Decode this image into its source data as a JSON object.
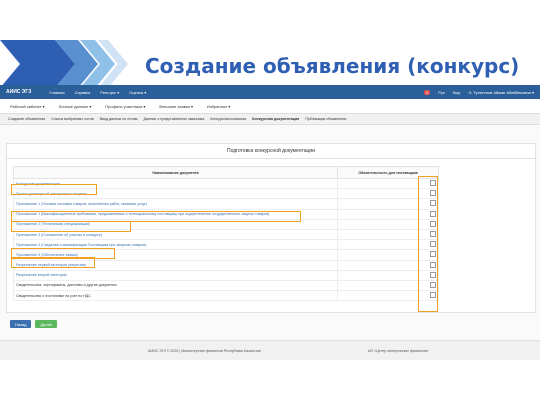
{
  "slide": {
    "title": "Создание объявления (конкурс)",
    "colors": {
      "title": "#2e5fb3",
      "logo_dark": "#2e5fb3",
      "logo_light": "#8fc0e8",
      "highlight": "#f0a020"
    }
  },
  "app": {
    "brand": "АИИС ЭГЗ",
    "nav": [
      "Главная",
      "Справка",
      "Реестры ▾",
      "Оценка ▾"
    ],
    "notif_count": "2",
    "lang": [
      "Рус",
      "Кыр"
    ],
    "user": "Э. Тулегенов Айжан Абайбековна ▾"
  },
  "subnav": [
    "Рабочий кабинет ▾",
    "Личные данные ▾",
    "Профиль участника ▾",
    "Внешние заявки ▾",
    "Избранное ▾"
  ],
  "tabs": [
    {
      "label": "Создание объявления",
      "active": false
    },
    {
      "label": "Список выбранных лотов",
      "active": false
    },
    {
      "label": "Ввод данных по лотам",
      "active": false
    },
    {
      "label": "Данные о представителях заказчика",
      "active": false
    },
    {
      "label": "Конкурсная комиссия",
      "active": false
    },
    {
      "label": "Конкурсная документация",
      "active": true
    },
    {
      "label": "Публикация объявления",
      "active": false
    }
  ],
  "panel": {
    "title": "Подготовка конкурсной документации",
    "columns": [
      "Наименование документа",
      "Обязательность для поставщика"
    ],
    "rows": [
      {
        "name": "Конкурсная документация",
        "link": true
      },
      {
        "name": "Проект договора об электронных закупках",
        "link": true
      },
      {
        "name": "Приложение 1 (Условия поставки товаров, выполнения работ, оказания услуг)",
        "link": true
      },
      {
        "name": "Приложение 1 (Квалификационные требования, предъявляемые к потенциальному поставщику при осуществлении государственных закупок товаров)",
        "link": true
      },
      {
        "name": "Приложение 2 (Техническая спецификация)",
        "link": true
      },
      {
        "name": "Приложение 3 (Соглашение об участии в конкурсе)",
        "link": true
      },
      {
        "name": "Приложение 4 (Сведения о квалификации Поставщика при закупках товаров)",
        "link": true
      },
      {
        "name": "Приложение 5 (Обеспечение заявки)",
        "link": true
      },
      {
        "name": "Разрешение первой категории (лицензия)",
        "link": true
      },
      {
        "name": "Разрешение второй категории",
        "link": true
      },
      {
        "name": "Свидетельства, сертификаты, дипломы и другие документы",
        "link": false
      },
      {
        "name": "Свидетельство о постановке на учет по НДС",
        "link": false
      }
    ]
  },
  "buttons": {
    "back": "Назад",
    "next": "Далее"
  },
  "footer": {
    "left": "АИИС ЭГЗ © 2020 | Министерство финансов Республики Казахстан",
    "right": "АО «Центр электронных финансов»"
  }
}
